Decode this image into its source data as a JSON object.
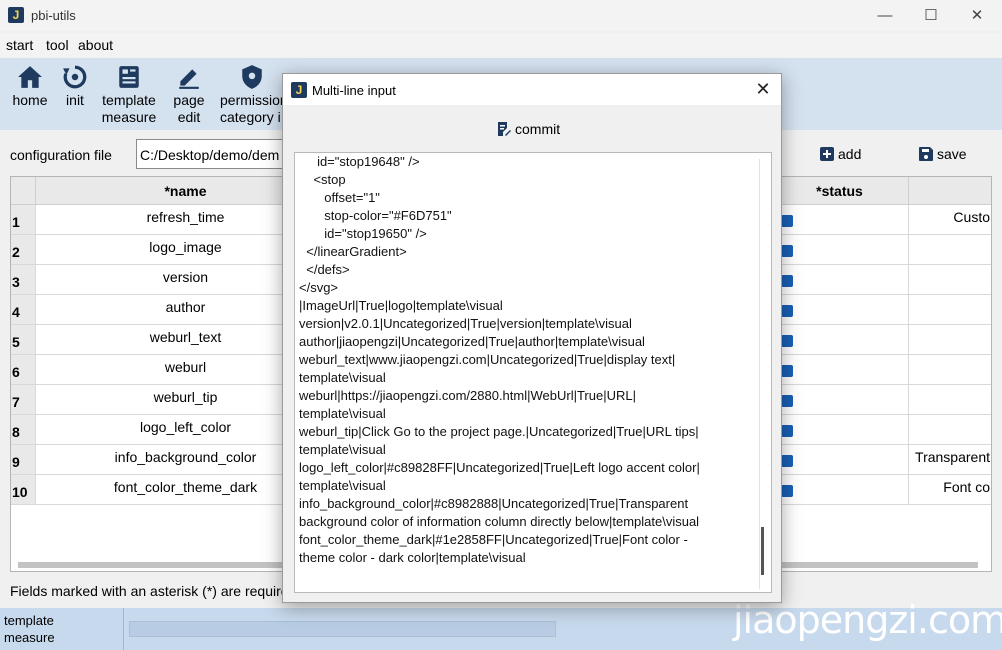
{
  "window": {
    "icon": "J",
    "title": "pbi-utils"
  },
  "menu": [
    "start",
    "tool",
    "about"
  ],
  "toolbar": [
    {
      "label": "home",
      "icon": "home-icon"
    },
    {
      "label": "init",
      "icon": "init-icon"
    },
    {
      "label": "template\nmeasure",
      "icon": "template-icon"
    },
    {
      "label": "page\nedit",
      "icon": "edit-icon"
    },
    {
      "label": "permission\ncategory i",
      "icon": "shield-icon"
    }
  ],
  "config": {
    "label": "configuration file",
    "value": "C:/Desktop/demo/dem"
  },
  "actions": {
    "add": "add",
    "save": "save"
  },
  "grid": {
    "headers": {
      "name": "*name",
      "status": "*status"
    },
    "rows": [
      {
        "num": "1",
        "name": "refresh_time",
        "extra": "Custo"
      },
      {
        "num": "2",
        "name": "logo_image",
        "extra": ""
      },
      {
        "num": "3",
        "name": "version",
        "extra": ""
      },
      {
        "num": "4",
        "name": "author",
        "extra": ""
      },
      {
        "num": "5",
        "name": "weburl_text",
        "extra": ""
      },
      {
        "num": "6",
        "name": "weburl",
        "extra": ""
      },
      {
        "num": "7",
        "name": "weburl_tip",
        "extra": ""
      },
      {
        "num": "8",
        "name": "logo_left_color",
        "extra": ""
      },
      {
        "num": "9",
        "name": "info_background_color",
        "extra": "Transparent"
      },
      {
        "num": "10",
        "name": "font_color_theme_dark",
        "extra": "Font co"
      }
    ]
  },
  "footnote": "Fields marked with an asterisk (*) are require",
  "statusbar": {
    "left": "template\nmeasure"
  },
  "watermark": "jiaopengzi.com",
  "dialog": {
    "icon": "J",
    "title": "Multi-line input",
    "commit": "commit",
    "text": "     id=\"stop19648\" />\n    <stop\n       offset=\"1\"\n       stop-color=\"#F6D751\"\n       id=\"stop19650\" />\n  </linearGradient>\n  </defs>\n</svg>\n|ImageUrl|True|logo|template\\visual\nversion|v2.0.1|Uncategorized|True|version|template\\visual\nauthor|jiaopengzi|Uncategorized|True|author|template\\visual\nweburl_text|www.jiaopengzi.com|Uncategorized|True|display text|\ntemplate\\visual\nweburl|https://jiaopengzi.com/2880.html|WebUrl|True|URL|\ntemplate\\visual\nweburl_tip|Click Go to the project page.|Uncategorized|True|URL tips|\ntemplate\\visual\nlogo_left_color|#c89828FF|Uncategorized|True|Left logo accent color|\ntemplate\\visual\ninfo_background_color|#c8982888|Uncategorized|True|Transparent\nbackground color of information column directly below|template\\visual\nfont_color_theme_dark|#1e2858FF|Uncategorized|True|Font color -\ntheme color - dark color|template\\visual"
  },
  "colors": {
    "toolbar_bg": "#d4e1ef",
    "accent": "#1a5fb4",
    "statusbar_bg": "#c7d9ec"
  }
}
